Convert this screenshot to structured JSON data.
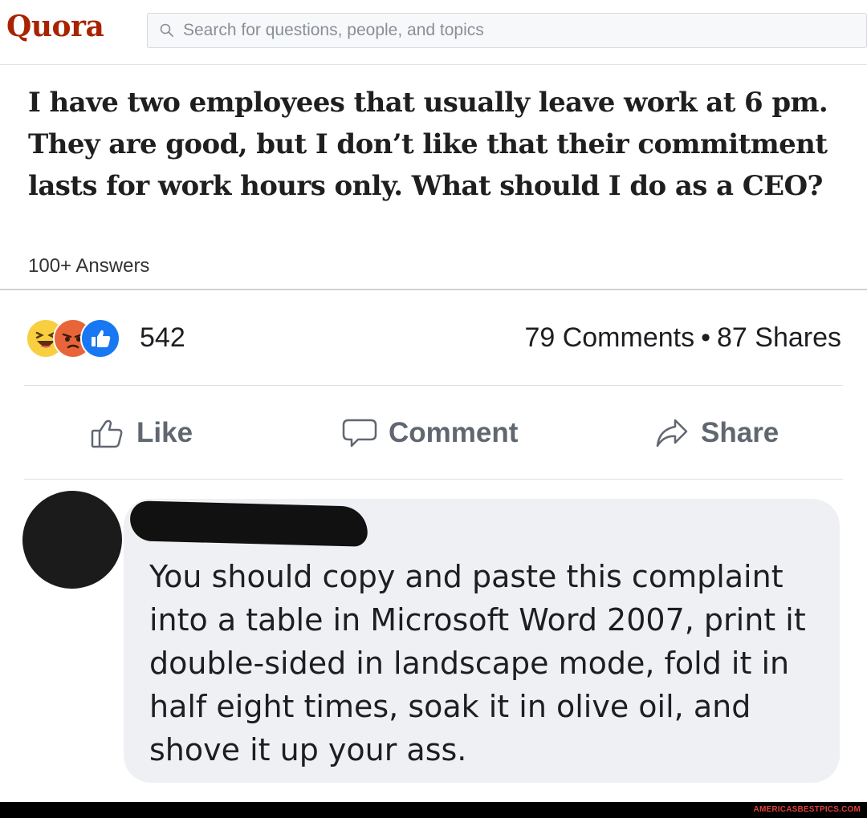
{
  "quora": {
    "logo": "Quora",
    "search_placeholder": "Search for questions, people, and topics",
    "question": "I have two employees that usually leave work at 6 pm. They are good, but I don’t like that their commitment lasts for work hours only. What should I do as a CEO?",
    "answers_count": "100+ Answers",
    "brand_color": "#a82400"
  },
  "facebook": {
    "reactions": [
      "haha-icon",
      "angry-icon",
      "like-icon"
    ],
    "reaction_count": "542",
    "comments": "79 Comments",
    "separator": "•",
    "shares": "87 Shares",
    "actions": {
      "like": "Like",
      "comment": "Comment",
      "share": "Share"
    },
    "comment_text": "You should copy and paste this complaint into a table in Microsoft Word 2007, print it double-sided in landscape mode, fold it in half eight times, soak it in olive oil, and shove it up your ass."
  },
  "watermark": "AMERICASBESTPICS.COM"
}
